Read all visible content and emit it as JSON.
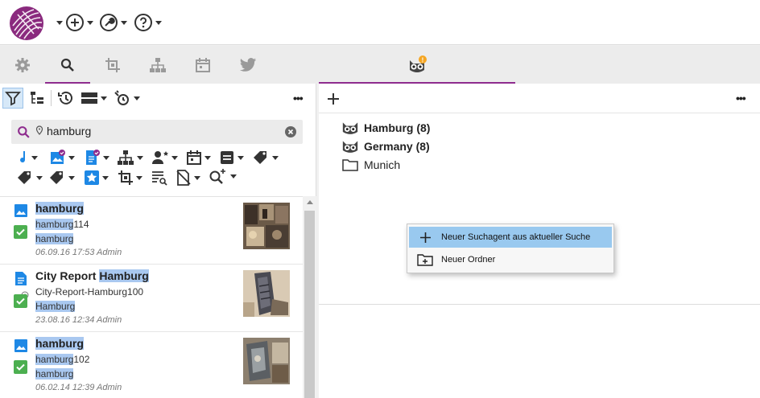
{
  "colors": {
    "accent": "#8e2c8e",
    "highlight": "#a9c8f0",
    "menu_hover": "#99c9ef",
    "check_green": "#4caf50",
    "icon_blue": "#1e88e5"
  },
  "topbar": {
    "icons": [
      "logo",
      "add-circle-icon",
      "wrench-icon",
      "help-icon"
    ]
  },
  "tabs": {
    "left": [
      "gear-icon",
      "search-icon",
      "crop-icon",
      "hierarchy-icon",
      "calendar-icon",
      "twitter-icon"
    ],
    "right": [
      "owl-icon"
    ],
    "active_left": "search-icon",
    "notification_badge": "!"
  },
  "search": {
    "value": "hamburg"
  },
  "results": [
    {
      "title": "hamburg",
      "title_pre": "",
      "title_hl": "hamburg",
      "l2_hl": "hamburg",
      "l2_rest": "114",
      "l3_hl": "hamburg",
      "meta": "06.09.16 17:53 Admin",
      "type": "image"
    },
    {
      "title_pre": "City Report ",
      "title_hl": "Hamburg",
      "l2_hl": "",
      "l2_rest": "City-Report-Hamburg100",
      "l3_hl": "Hamburg",
      "meta": "23.08.16 12:34 Admin",
      "type": "document"
    },
    {
      "title_pre": "",
      "title_hl": "hamburg",
      "l2_hl": "hamburg",
      "l2_rest": "102",
      "l3_hl": "hamburg",
      "meta": "06.02.14 12:39 Admin",
      "type": "image"
    }
  ],
  "tree": [
    {
      "label": "Hamburg (8)",
      "icon": "owl-icon",
      "bold": true
    },
    {
      "label": "Germany (8)",
      "icon": "owl-icon",
      "bold": true
    },
    {
      "label": "Munich",
      "icon": "folder-icon",
      "bold": false
    }
  ],
  "context_menu": {
    "items": [
      {
        "label": "Neuer Suchagent aus aktueller Suche",
        "icon": "plus-icon",
        "hover": true
      },
      {
        "label": "Neuer Ordner",
        "icon": "folder-add-icon",
        "hover": false
      }
    ]
  },
  "more_label": "•••"
}
